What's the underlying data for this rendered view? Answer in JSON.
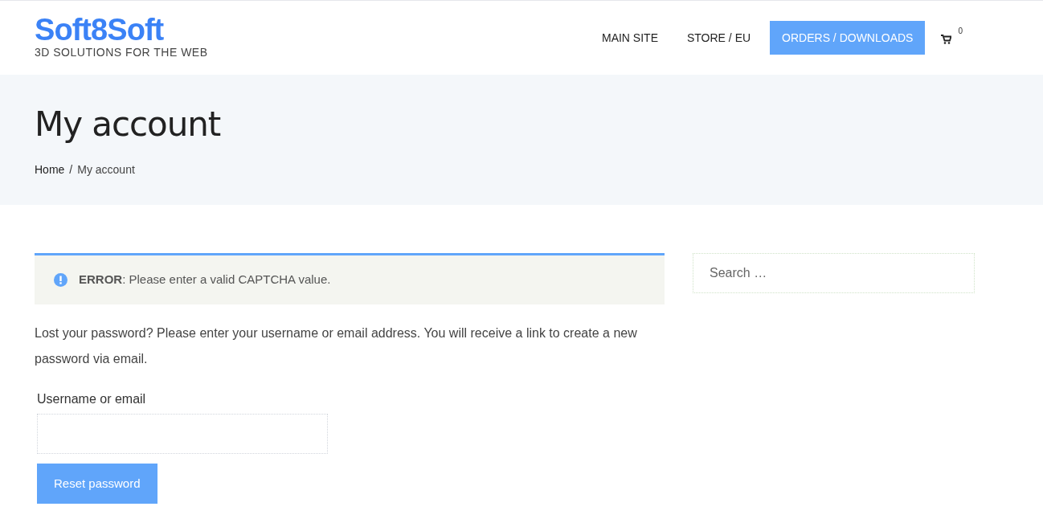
{
  "logo": {
    "name": "Soft8Soft",
    "tagline": "3D SOLUTIONS FOR THE WEB"
  },
  "nav": [
    {
      "label": "MAIN SITE",
      "selected": false
    },
    {
      "label": "STORE / EU",
      "selected": false
    },
    {
      "label": "ORDERS / DOWNLOADS",
      "selected": true
    }
  ],
  "cart": {
    "count": "0"
  },
  "hero": {
    "title": "My account",
    "breadcrumb": [
      {
        "label": "Home",
        "kind": "link"
      },
      {
        "label": "My account",
        "kind": "current"
      }
    ],
    "separator": "/"
  },
  "notice": {
    "text": "**ERROR**: Please enter a valid CAPTCHA value."
  },
  "intro": "Lost your password? Please enter your username or email address. You will receive a link to create a new password via email.",
  "form": {
    "label": "Username or email",
    "button": "Reset password"
  },
  "search": {
    "placeholder": "Search …"
  }
}
